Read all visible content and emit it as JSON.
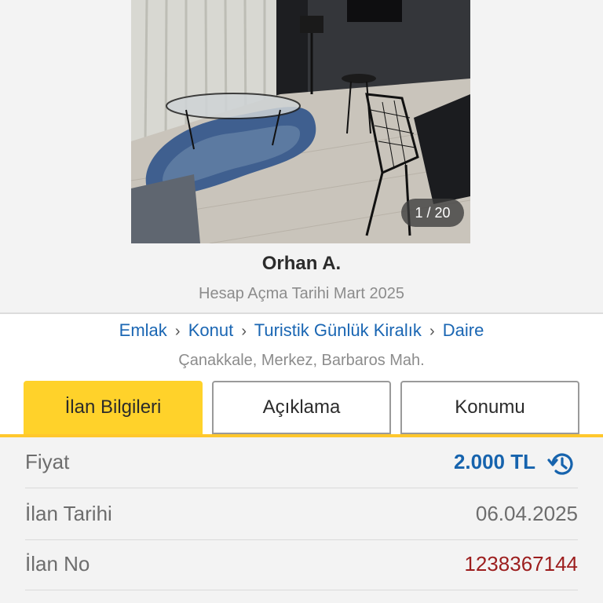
{
  "gallery": {
    "counter": "1 / 20",
    "photo_alt": "living room photo"
  },
  "seller": {
    "name": "Orhan A.",
    "account_since": "Hesap Açma Tarihi Mart 2025"
  },
  "breadcrumb": {
    "items": [
      "Emlak",
      "Konut",
      "Turistik Günlük Kiralık",
      "Daire"
    ],
    "separator": "›"
  },
  "location": "Çanakkale, Merkez, Barbaros Mah.",
  "tabs": [
    {
      "label": "İlan Bilgileri",
      "active": true
    },
    {
      "label": "Açıklama",
      "active": false
    },
    {
      "label": "Konumu",
      "active": false
    }
  ],
  "details": {
    "price_label": "Fiyat",
    "price_value": "2.000 TL",
    "date_label": "İlan Tarihi",
    "date_value": "06.04.2025",
    "no_label": "İlan No",
    "no_value": "1238367144"
  },
  "colors": {
    "accent": "#ffd22a",
    "link": "#1a66b3",
    "price": "#1663ad",
    "listing_no": "#9c1d1d"
  },
  "icons": {
    "price_history": "history-icon"
  }
}
